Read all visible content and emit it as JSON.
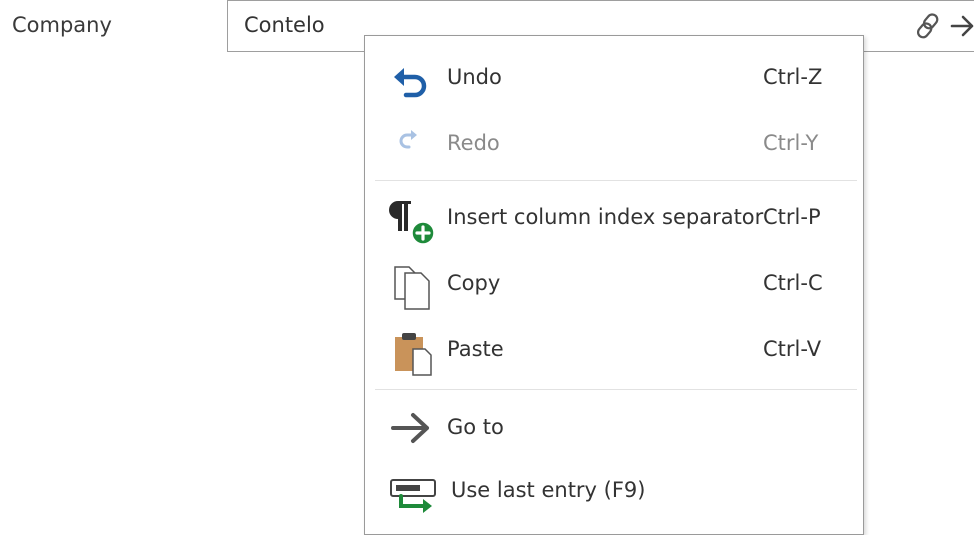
{
  "field": {
    "label": "Company",
    "value": "Contelo"
  },
  "icons": {
    "link": "link-icon",
    "go": "arrow-right-icon"
  },
  "context_menu": {
    "items": [
      {
        "label": "Undo",
        "shortcut": "Ctrl-Z",
        "icon": "undo-icon",
        "enabled": true
      },
      {
        "label": "Redo",
        "shortcut": "Ctrl-Y",
        "icon": "redo-icon",
        "enabled": false
      },
      {
        "label": "Insert column index separator",
        "shortcut": "Ctrl-P",
        "icon": "pilcrow-add-icon",
        "enabled": true
      },
      {
        "label": "Copy",
        "shortcut": "Ctrl-C",
        "icon": "copy-icon",
        "enabled": true
      },
      {
        "label": "Paste",
        "shortcut": "Ctrl-V",
        "icon": "paste-icon",
        "enabled": true
      },
      {
        "label": "Go to",
        "shortcut": "",
        "icon": "arrow-right-icon",
        "enabled": true
      },
      {
        "label": "Use last entry (F9)",
        "shortcut": "",
        "icon": "use-last-entry-icon",
        "enabled": true
      }
    ]
  },
  "colors": {
    "undo_blue": "#1f5fa8",
    "redo_disabled": "#a9c2e3",
    "green_add": "#1e8a3a",
    "paste_brown": "#c9935a"
  }
}
